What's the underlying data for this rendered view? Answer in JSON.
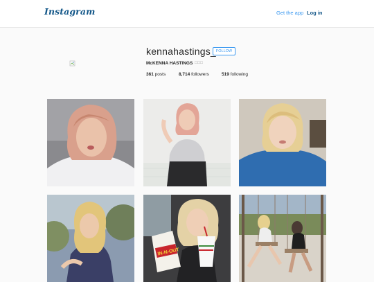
{
  "header": {
    "logo_text": "Instagram",
    "get_app_label": "Get the app",
    "login_label": "Log in"
  },
  "profile": {
    "username": "kennahastings_",
    "follow_label": "FOLLOW",
    "full_name": "McKENNA HASTINGS",
    "full_name_suffix": "□□□",
    "posts_count": "361",
    "posts_label": "posts",
    "followers_count": "8,714",
    "followers_label": "followers",
    "following_count": "519",
    "following_label": "following"
  },
  "posts": [
    {
      "subject": "pink bob selfie, white top"
    },
    {
      "subject": "pink bob mirror pose, grey crop top"
    },
    {
      "subject": "blonde bob selfie, blue sweatshirt"
    },
    {
      "subject": "blonde hair outdoors, floral outfit"
    },
    {
      "subject": "car selfie with In-N-Out bag and cup"
    },
    {
      "subject": "two friends on swings"
    }
  ],
  "photo_overlay_text": "IN-N-OUT",
  "colors": {
    "link_blue": "#3897f0",
    "logo_blue": "#125688",
    "background": "#fafafa"
  }
}
